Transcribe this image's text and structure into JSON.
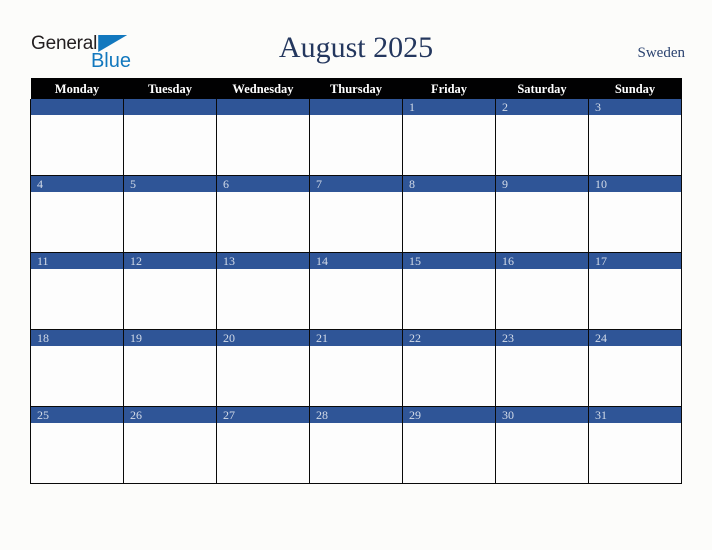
{
  "brand": {
    "name_part1": "General",
    "name_part2": "Blue",
    "triangle_icon": "triangle-icon",
    "primary_color": "#1278be"
  },
  "header": {
    "title": "August 2025",
    "month": "August",
    "year": "2025",
    "region": "Sweden"
  },
  "theme": {
    "header_bg": "#010102",
    "header_text": "#ffffff",
    "date_bar_bg": "#2f5597",
    "date_bar_text": "#d3dbe8",
    "cell_bg": "#fdfdfd",
    "page_bg": "#fcfcfa",
    "title_color": "#24375e",
    "region_color": "#2b4370"
  },
  "calendar": {
    "weekday_headers": [
      "Monday",
      "Tuesday",
      "Wednesday",
      "Thursday",
      "Friday",
      "Saturday",
      "Sunday"
    ],
    "weeks": [
      [
        "",
        "",
        "",
        "",
        "1",
        "2",
        "3"
      ],
      [
        "4",
        "5",
        "6",
        "7",
        "8",
        "9",
        "10"
      ],
      [
        "11",
        "12",
        "13",
        "14",
        "15",
        "16",
        "17"
      ],
      [
        "18",
        "19",
        "20",
        "21",
        "22",
        "23",
        "24"
      ],
      [
        "25",
        "26",
        "27",
        "28",
        "29",
        "30",
        "31"
      ]
    ]
  }
}
